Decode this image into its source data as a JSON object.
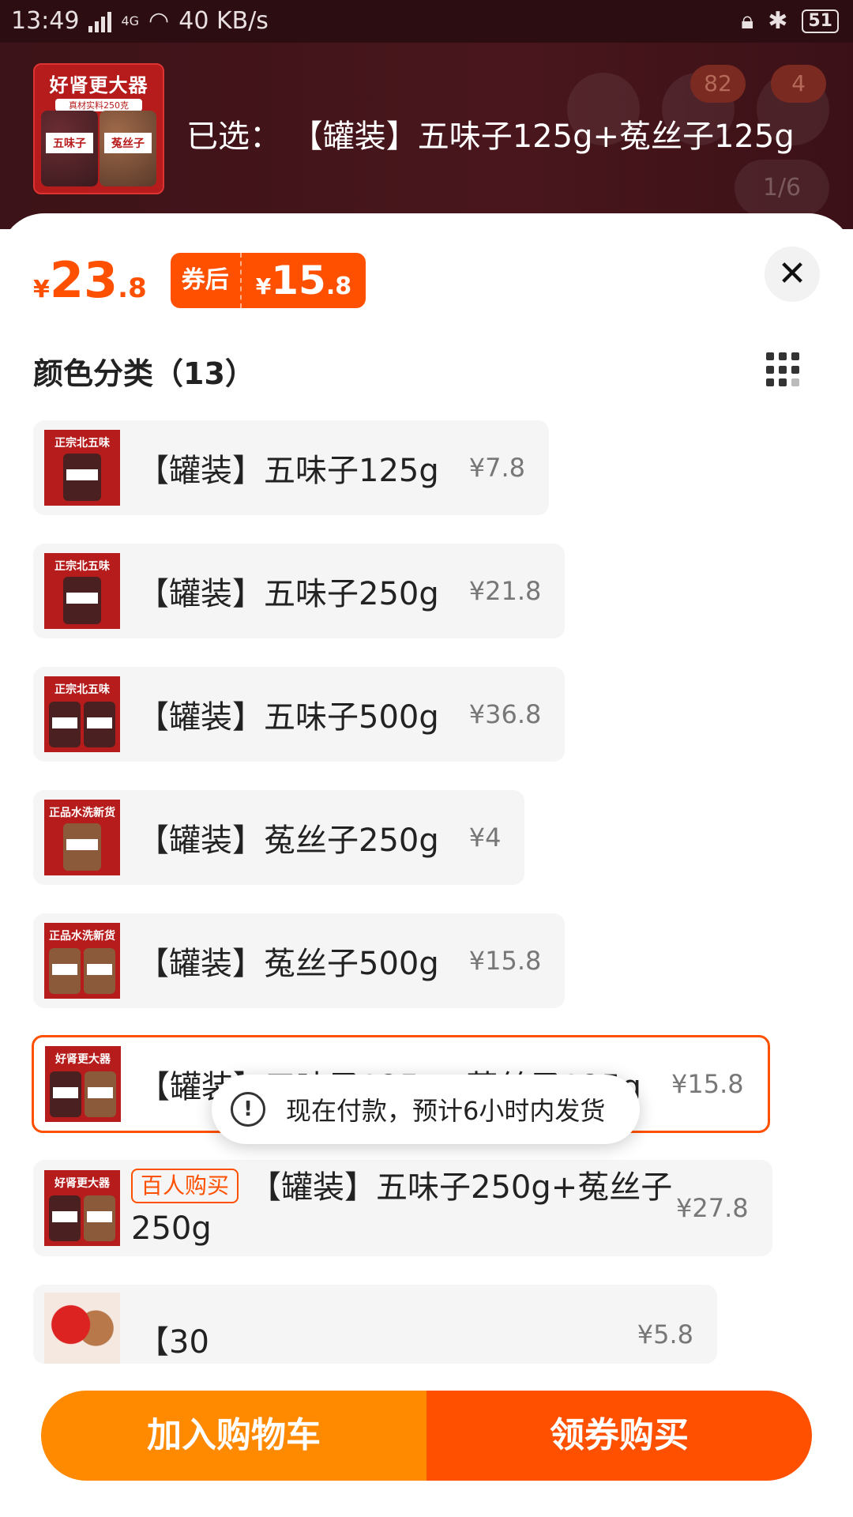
{
  "status_bar": {
    "time": "13:49",
    "network": "4G",
    "speed": "40 KB/s",
    "battery": "51"
  },
  "header": {
    "cart_count": "82",
    "more_count": "4",
    "pager": "1/6",
    "product_thumb_title": "好肾更大器",
    "product_thumb_sub": "真材实料250克",
    "thumb_jar_left": "五味子",
    "thumb_jar_right": "菟丝子",
    "selected_label": "已选：",
    "selected_value": "【罐装】五味子125g+菟丝子125g"
  },
  "price": {
    "yen": "¥",
    "int": "23",
    "dec": ".8",
    "coupon_tag": "券后",
    "coupon_yen": "¥",
    "coupon_int": "15",
    "coupon_dec": ".8"
  },
  "close_symbol": "✕",
  "section": {
    "title": "颜色分类（13）"
  },
  "options": [
    {
      "thumb_title": "正宗北五味",
      "name": "【罐装】五味子125g",
      "price": "¥7.8"
    },
    {
      "thumb_title": "正宗北五味",
      "name": "【罐装】五味子250g",
      "price": "¥21.8"
    },
    {
      "thumb_title": "正宗北五味",
      "name": "【罐装】五味子500g",
      "price": "¥36.8"
    },
    {
      "thumb_title": "正品水洗新货",
      "name": "【罐装】菟丝子250g",
      "price": "¥4"
    },
    {
      "thumb_title": "正品水洗新货",
      "name": "【罐装】菟丝子500g",
      "price": "¥15.8"
    },
    {
      "thumb_title": "好肾更大器",
      "name": "【罐装】五味子125g+菟丝子125g",
      "price": "¥15.8"
    },
    {
      "thumb_title": "好肾更大器",
      "badge": "百人购买",
      "name": "【罐装】五味子250g+菟丝子250g",
      "price": "¥27.8"
    },
    {
      "name": "【30",
      "price": "¥5.8"
    }
  ],
  "toast": {
    "icon": "!",
    "text": "现在付款，预计6小时内发货"
  },
  "actions": {
    "add_to_cart": "加入购物车",
    "buy_with_coupon": "领券购买"
  }
}
